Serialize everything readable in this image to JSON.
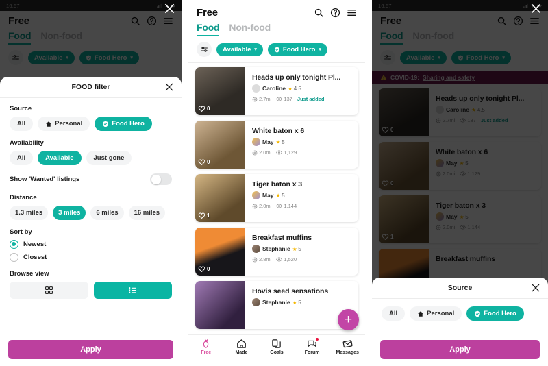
{
  "theme": {
    "teal": "#0fb3a1",
    "teal_dark": "#0c9a8b",
    "magenta": "#bc409e",
    "fab_pink": "#c245a6",
    "nav_active": "#d8499b",
    "covid_bg": "#6e1b4e",
    "chip_bg": "#f3f4f5",
    "dim": "rgba(0,0,0,0.72)"
  },
  "status_bar": {
    "time": "16:57",
    "signal": "signal-icon",
    "wifi": "wifi-icon",
    "battery": "battery-icon"
  },
  "app": {
    "title": "Free",
    "header_icons": [
      "search-icon",
      "help-icon",
      "menu-icon"
    ],
    "tabs": [
      {
        "label": "Food",
        "active": true
      },
      {
        "label": "Non-food",
        "active": false
      }
    ],
    "filter_bar": {
      "sliders_icon": "sliders-icon",
      "chips": [
        {
          "label": "Available",
          "icon": null,
          "caret": "▾"
        },
        {
          "label": "Food Hero",
          "icon": "shield-check-icon",
          "caret": "▾"
        }
      ]
    },
    "covid_banner": {
      "icon": "warning-icon",
      "prefix": "COVID-19:",
      "link": "Sharing and safety"
    },
    "close_icon": "close-icon"
  },
  "listings": [
    {
      "title": "Heads up only tonight Pl...",
      "user": "Caroline",
      "rating": "4.5",
      "distance": "2.7mi",
      "views": "137",
      "status": "Just added",
      "favourites": "0",
      "thumb_colors": [
        "#5a5147",
        "#3a332c"
      ],
      "avatar_color": "#d8d8d8"
    },
    {
      "title": "White baton x 6",
      "user": "May",
      "rating": "5",
      "distance": "2.0mi",
      "views": "1,129",
      "status": "",
      "favourites": "0",
      "thumb_colors": [
        "#b99f80",
        "#7d6647"
      ],
      "avatar_color": "#8fa6d8"
    },
    {
      "title": "Tiger baton x 3",
      "user": "May",
      "rating": "5",
      "distance": "2.0mi",
      "views": "1,144",
      "status": "",
      "favourites": "1",
      "thumb_colors": [
        "#c0a378",
        "#6d5534"
      ],
      "avatar_color": "#8fa6d8"
    },
    {
      "title": "Breakfast muffins",
      "user": "Stephanie",
      "rating": "5",
      "distance": "2.8mi",
      "views": "1,520",
      "status": "",
      "favourites": "0",
      "thumb_colors": [
        "#e8873a",
        "#1c1b19"
      ],
      "avatar_color": "#8a7363"
    },
    {
      "title": "Hovis seed sensations",
      "user": "Stephanie",
      "rating": "5",
      "distance": "",
      "views": "",
      "status": "",
      "favourites": "",
      "thumb_colors": [
        "#3a2146",
        "#8d6aa0"
      ],
      "avatar_color": "#8a7363"
    }
  ],
  "fab": {
    "icon": "plus-icon",
    "label": "+"
  },
  "bottom_nav": [
    {
      "label": "Free",
      "icon": "apple-icon",
      "active": true,
      "badge": false
    },
    {
      "label": "Made",
      "icon": "home-icon",
      "active": false,
      "badge": false
    },
    {
      "label": "Goals",
      "icon": "documents-icon",
      "active": false,
      "badge": false
    },
    {
      "label": "Forum",
      "icon": "chat-icon",
      "active": false,
      "badge": true
    },
    {
      "label": "Messages",
      "icon": "envelope-icon",
      "active": false,
      "badge": false
    }
  ],
  "food_filter_sheet": {
    "title": "FOOD filter",
    "close_icon": "close-icon",
    "sections": {
      "source": {
        "label": "Source",
        "options": [
          {
            "label": "All",
            "icon": null,
            "selected": false
          },
          {
            "label": "Personal",
            "icon": "home-icon",
            "selected": false
          },
          {
            "label": "Food Hero",
            "icon": "shield-check-icon",
            "selected": true
          }
        ]
      },
      "availability": {
        "label": "Availability",
        "options": [
          {
            "label": "All",
            "selected": false
          },
          {
            "label": "Available",
            "selected": true
          },
          {
            "label": "Just gone",
            "selected": false
          }
        ]
      },
      "wanted_toggle": {
        "label": "Show 'Wanted' listings",
        "on": false
      },
      "distance": {
        "label": "Distance",
        "options": [
          {
            "label": "1.3 miles",
            "selected": false
          },
          {
            "label": "3 miles",
            "selected": true
          },
          {
            "label": "6 miles",
            "selected": false
          },
          {
            "label": "16 miles",
            "selected": false
          }
        ]
      },
      "sort_by": {
        "label": "Sort by",
        "options": [
          {
            "label": "Newest",
            "selected": true
          },
          {
            "label": "Closest",
            "selected": false
          }
        ]
      },
      "browse_view": {
        "label": "Browse view",
        "options": [
          {
            "icon": "grid-icon",
            "selected": false
          },
          {
            "icon": "list-icon",
            "selected": true
          }
        ]
      }
    },
    "apply_label": "Apply"
  },
  "source_sheet": {
    "title": "Source",
    "close_icon": "close-icon",
    "options": [
      {
        "label": "All",
        "icon": null,
        "selected": false
      },
      {
        "label": "Personal",
        "icon": "home-icon",
        "selected": false
      },
      {
        "label": "Food Hero",
        "icon": "shield-check-icon",
        "selected": true
      }
    ],
    "apply_label": "Apply"
  }
}
